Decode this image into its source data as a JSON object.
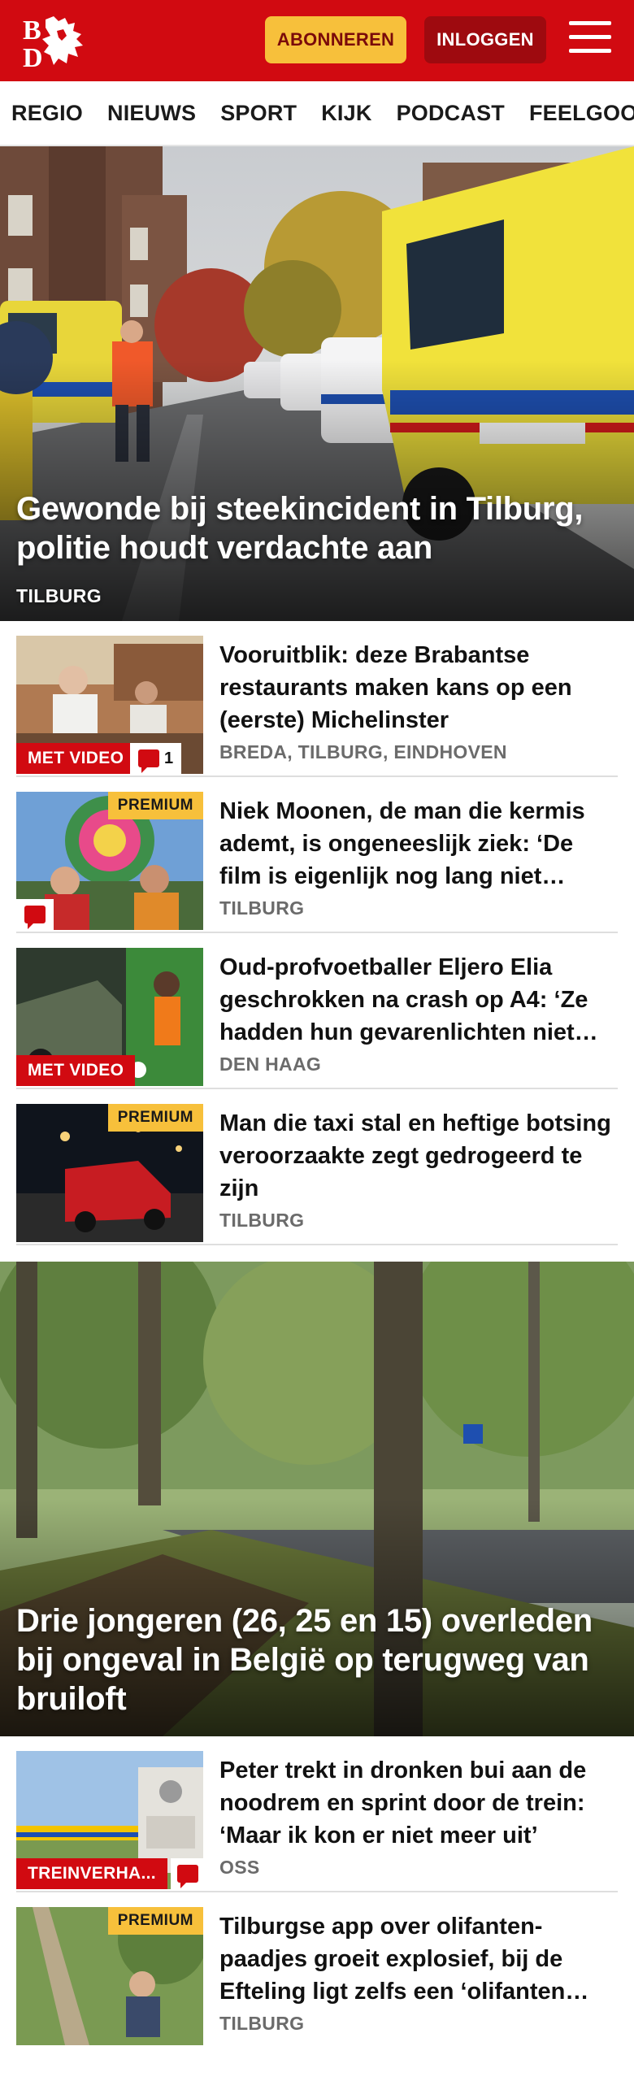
{
  "header": {
    "logo_text": "BD",
    "subscribe_label": "ABONNEREN",
    "login_label": "INLOGGEN"
  },
  "nav": {
    "items": [
      "REGIO",
      "NIEUWS",
      "SPORT",
      "KIJK",
      "PODCAST",
      "FEELGOOD"
    ]
  },
  "hero1": {
    "title": "Gewonde bij steekincident in Tilburg, politie houdt verdachte aan",
    "location": "TILBURG"
  },
  "articles1": [
    {
      "title": "Vooruitblik: deze Brabantse restaurants maken kans op een (eerste) Michelinster",
      "location": "BREDA, TILBURG, EINDHOVEN",
      "video_label": "MET VIDEO",
      "comment_count": "1"
    },
    {
      "title": "Niek Moonen, de man die kermis ademt, is ongeneeslijk ziek: ‘De film is eigenlijk nog lang niet…",
      "location": "TILBURG",
      "premium_label": "PREMIUM"
    },
    {
      "title": "Oud-profvoetballer Eljero Elia geschrokken na crash op A4: ‘Ze hadden hun gevarenlichten niet…",
      "location": "DEN HAAG",
      "video_label": "MET VIDEO"
    },
    {
      "title": "Man die taxi stal en heftige botsing veroorzaakte zegt gedrogeerd te zijn",
      "location": "TILBURG",
      "premium_label": "PREMIUM"
    }
  ],
  "hero2": {
    "title": "Drie jongeren (26, 25 en 15) overleden bij ongeval in België op terugweg van bruiloft"
  },
  "articles2": [
    {
      "title": "Peter trekt in dronken bui aan de noodrem en sprint door de trein: ‘Maar ik kon er niet meer uit’",
      "location": "OSS",
      "tag_label": "TREINVERHA..."
    },
    {
      "title": "Tilburgse app over olifanten-paadjes groeit explosief, bij de Efteling ligt zelfs een ‘olifanten…",
      "location": "TILBURG",
      "premium_label": "PREMIUM"
    }
  ],
  "colors": {
    "brand_red": "#d10a11",
    "premium_yellow": "#f7c03b",
    "login_dark_red": "#9e0a0f"
  }
}
